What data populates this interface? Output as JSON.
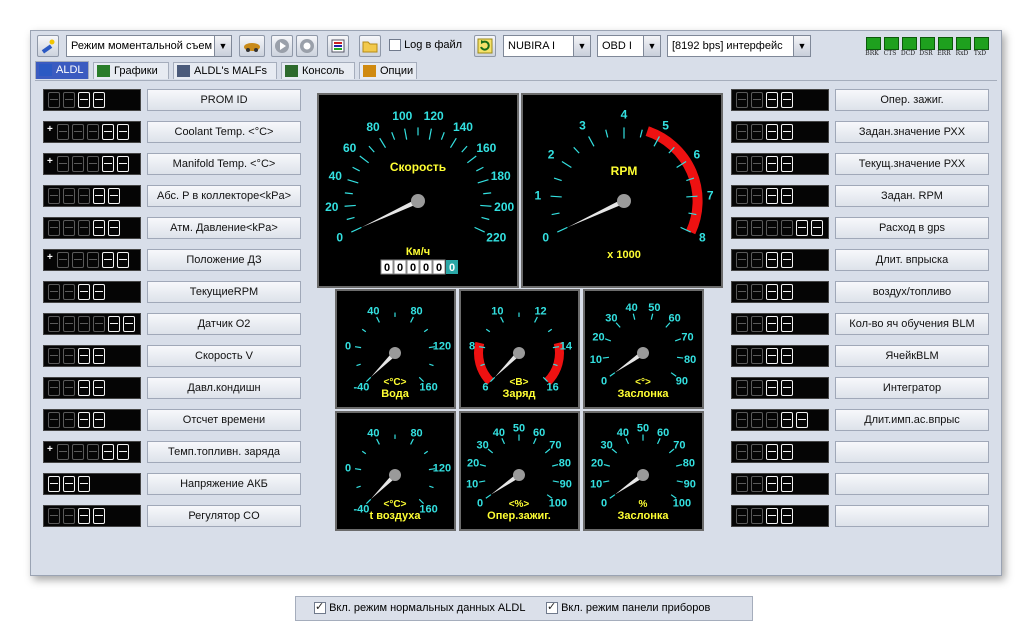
{
  "toolbar": {
    "mode_combo": "Режим моментальной съем",
    "log_label": "Log в файл",
    "car_combo": "NUBIRA I",
    "protocol_combo": "OBD I",
    "interface_combo": "[8192 bps] интерфейс",
    "leds": [
      "BRK",
      "CTS",
      "DCD",
      "DSR",
      "ERR",
      "RxD",
      "TxD"
    ]
  },
  "tabs": [
    {
      "label": "ALDL",
      "icon": "aldl-icon"
    },
    {
      "label": "Графики",
      "icon": "chart-icon"
    },
    {
      "label": "ALDL's MALFs",
      "icon": "list-icon"
    },
    {
      "label": "Консоль",
      "icon": "console-icon"
    },
    {
      "label": "Опции",
      "icon": "options-icon"
    }
  ],
  "left_params": [
    {
      "label": "PROM ID",
      "digits": 4,
      "sign": false
    },
    {
      "label": "Coolant Temp. <°C>",
      "digits": 5,
      "sign": true
    },
    {
      "label": "Manifold Temp. <°C>",
      "digits": 5,
      "sign": true
    },
    {
      "label": "Абс. P в коллекторе<kPa>",
      "digits": 5,
      "sign": false
    },
    {
      "label": "Атм. Давление<kPa>",
      "digits": 5,
      "sign": false
    },
    {
      "label": "Положение ДЗ",
      "digits": 5,
      "sign": true
    },
    {
      "label": "ТекущиеRPM",
      "digits": 4,
      "sign": false
    },
    {
      "label": "Датчик О2",
      "digits": 6,
      "sign": false
    },
    {
      "label": "Скорость V",
      "digits": 4,
      "sign": false
    },
    {
      "label": "Давл.кондишн",
      "digits": 4,
      "sign": false
    },
    {
      "label": "Отсчет времени",
      "digits": 4,
      "sign": false
    },
    {
      "label": "Темп.топливн. заряда",
      "digits": 5,
      "sign": true
    },
    {
      "label": "Напряжение АКБ",
      "digits": 3,
      "sign": false
    },
    {
      "label": "Регулятор CO",
      "digits": 4,
      "sign": false
    }
  ],
  "right_params": [
    {
      "label": "Опер. зажиг.",
      "digits": 4
    },
    {
      "label": "Задан.значение РХХ",
      "digits": 4
    },
    {
      "label": "Текущ.значение РХХ",
      "digits": 4
    },
    {
      "label": "Задан. RPM",
      "digits": 4
    },
    {
      "label": "Расход в gps",
      "digits": 6
    },
    {
      "label": "Длит. впрыска",
      "digits": 4
    },
    {
      "label": "воздух/топливо",
      "digits": 4
    },
    {
      "label": "Кол-во яч обучения BLM",
      "digits": 4
    },
    {
      "label": "ЯчейкBLM",
      "digits": 4
    },
    {
      "label": "Интегратор",
      "digits": 4
    },
    {
      "label": "Длит.имп.ас.впрыс",
      "digits": 5
    },
    {
      "label": "",
      "digits": 4
    },
    {
      "label": "",
      "digits": 4
    },
    {
      "label": "",
      "digits": 4
    }
  ],
  "gauges": {
    "speed": {
      "title": "Скорость",
      "unit": "Км/ч",
      "ticks": [
        "0",
        "20",
        "40",
        "60",
        "80",
        "100",
        "120",
        "140",
        "160",
        "180",
        "200",
        "220"
      ],
      "odometer": [
        "0",
        "0",
        "0",
        "0",
        "0"
      ],
      "odometer_last": "0",
      "value": 0
    },
    "rpm": {
      "title": "RPM",
      "unit": "x 1000",
      "ticks": [
        "0",
        "1",
        "2",
        "3",
        "4",
        "5",
        "6",
        "7",
        "8"
      ],
      "value": 0
    },
    "water": {
      "title": "Вода",
      "unit": "<°C>",
      "ticks": [
        "-40",
        "0",
        "40",
        "80",
        "120",
        "160"
      ],
      "value": -40
    },
    "charge": {
      "title": "Заряд",
      "unit": "<B>",
      "ticks": [
        "6",
        "8",
        "10",
        "12",
        "14",
        "16"
      ],
      "value": 6
    },
    "throttle": {
      "title": "Заслонка",
      "unit": "<°>",
      "ticks": [
        "0",
        "10",
        "20",
        "30",
        "40",
        "50",
        "60",
        "70",
        "80",
        "90"
      ],
      "value": 0
    },
    "air": {
      "title": "t воздуха",
      "unit": "<°C>",
      "ticks": [
        "-40",
        "0",
        "40",
        "80",
        "120",
        "160"
      ],
      "value": -40
    },
    "ignition": {
      "title": "Опер.зажиг.",
      "unit": "<%>",
      "ticks": [
        "0",
        "10",
        "20",
        "30",
        "40",
        "50",
        "60",
        "70",
        "80",
        "90",
        "100"
      ],
      "value": 0
    },
    "throttle_pct": {
      "title": "Заслонка",
      "unit": "%",
      "ticks": [
        "0",
        "10",
        "20",
        "30",
        "40",
        "50",
        "60",
        "70",
        "80",
        "90",
        "100"
      ],
      "value": 0
    }
  },
  "bottom": {
    "normal_data_label": "Вкл. режим нормальных данных ALDL",
    "panel_label": "Вкл. режим панели приборов",
    "normal_data_checked": true,
    "panel_checked": true
  },
  "colors": {
    "gauge_text": "#ffff33",
    "gauge_ticks": "#33e0e0",
    "needle": "#e6e6e6",
    "redzone": "#ee1111"
  }
}
